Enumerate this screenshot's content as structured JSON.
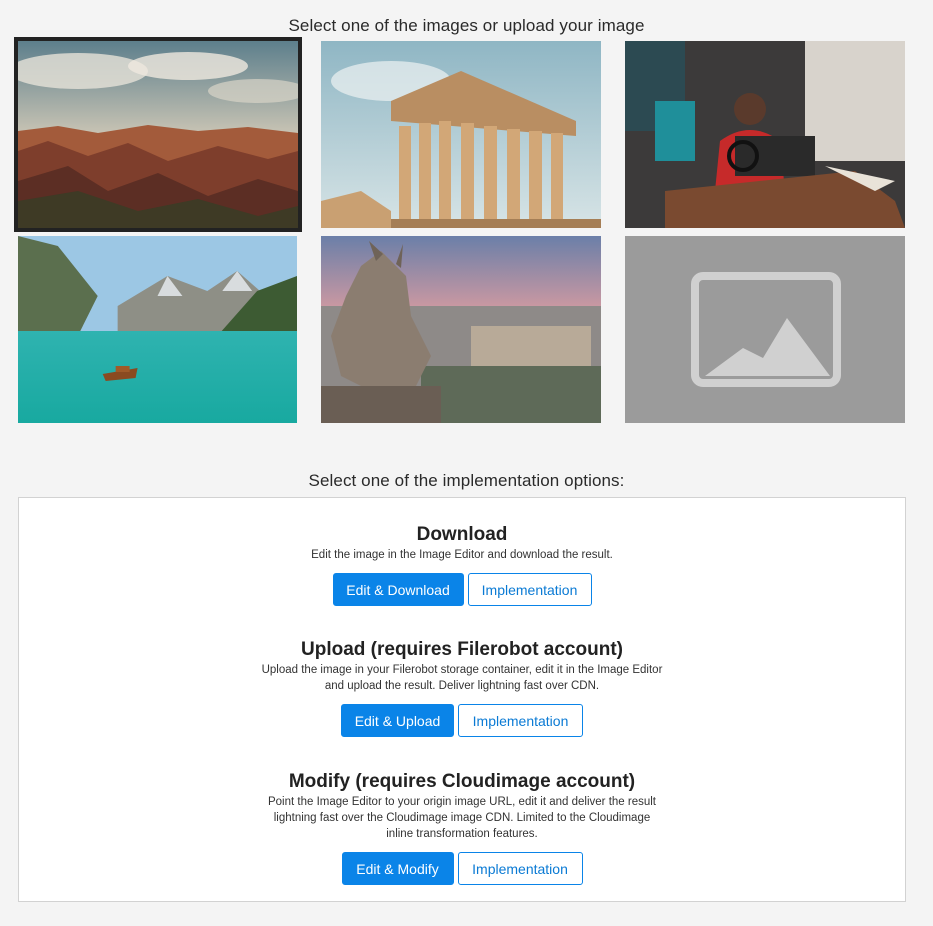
{
  "headings": {
    "images": "Select one of the images or upload your image",
    "options": "Select one of the implementation options:"
  },
  "gallery": {
    "selected_index": 0,
    "items": [
      {
        "icon": "canyon-landscape-image"
      },
      {
        "icon": "parthenon-ruins-image"
      },
      {
        "icon": "woman-sewing-image"
      },
      {
        "icon": "mountain-lake-boat-image"
      },
      {
        "icon": "gargoyle-paris-sunset-image"
      },
      {
        "icon": "upload-image-placeholder-icon"
      }
    ]
  },
  "options": [
    {
      "title": "Download",
      "desc_lines": [
        "Edit the image in the Image Editor and download the result."
      ],
      "primary": "Edit & Download",
      "secondary": "Implementation"
    },
    {
      "title": "Upload (requires Filerobot account)",
      "desc_lines": [
        "Upload the image in your Filerobot storage container, edit it in the Image Editor",
        "and upload the result. Deliver lightning fast over CDN."
      ],
      "primary": "Edit & Upload",
      "secondary": "Implementation"
    },
    {
      "title": "Modify (requires Cloudimage account)",
      "desc_lines": [
        "Point the Image Editor to your origin image URL, edit it and deliver the result",
        "lightning fast over the Cloudimage image CDN. Limited to the Cloudimage",
        "inline transformation features."
      ],
      "primary": "Edit & Modify",
      "secondary": "Implementation"
    }
  ],
  "colors": {
    "primary": "#0a84e8",
    "background": "#f4f4f4",
    "placeholder": "#9b9b9b"
  }
}
